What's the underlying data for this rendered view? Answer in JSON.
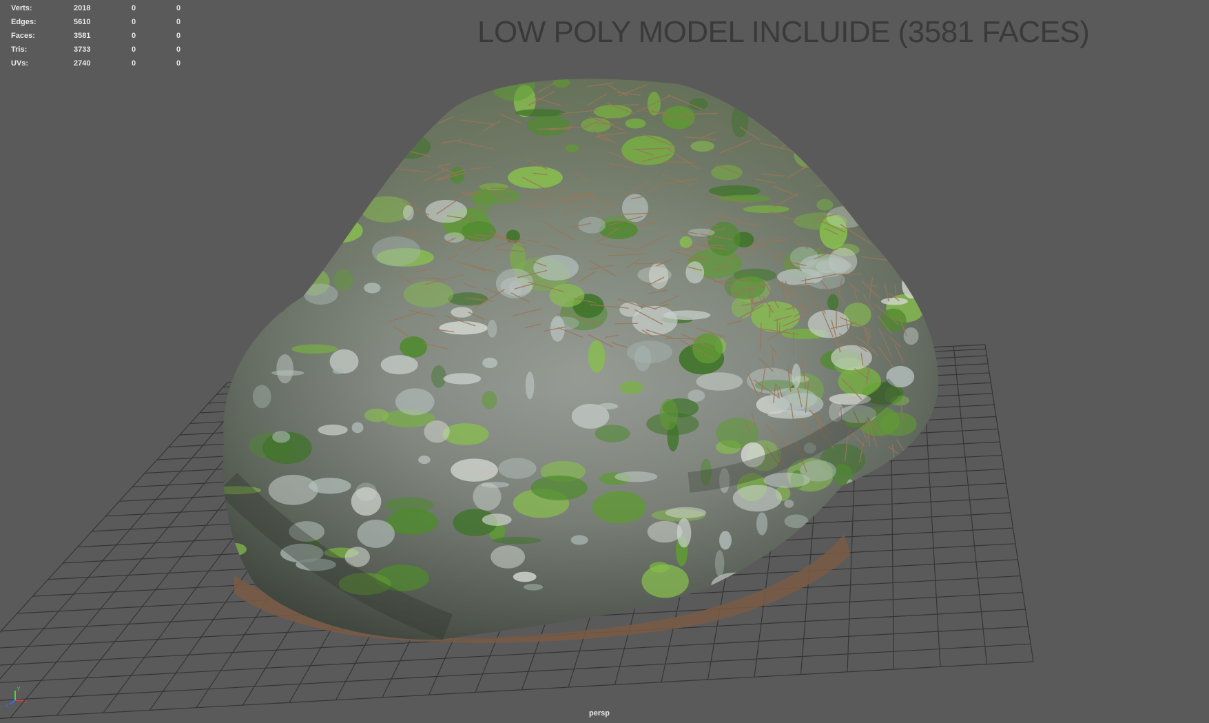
{
  "hud": {
    "rows": [
      {
        "label": "Verts:",
        "v1": "2018",
        "v2": "0",
        "v3": "0"
      },
      {
        "label": "Edges:",
        "v1": "5610",
        "v2": "0",
        "v3": "0"
      },
      {
        "label": "Faces:",
        "v1": "3581",
        "v2": "0",
        "v3": "0"
      },
      {
        "label": "Tris:",
        "v1": "3733",
        "v2": "0",
        "v3": "0"
      },
      {
        "label": "UVs:",
        "v1": "2740",
        "v2": "0",
        "v3": "0"
      }
    ]
  },
  "banner": {
    "text": "LOW POLY MODEL INCLUIDE (3581 FACES)"
  },
  "camera": {
    "label": "persp"
  },
  "axis": {
    "x_color": "#e23a3a",
    "y_color": "#4bd24b",
    "z_color": "#3b6df0"
  },
  "colors": {
    "background": "#5a5a5a",
    "grid": "#353535",
    "rock_base": "#8e9390",
    "moss": "#6aa53a",
    "pine_needles": "#8c6a4f"
  },
  "icons": {
    "axis_gizmo": "xyz-axis-gizmo-icon"
  }
}
